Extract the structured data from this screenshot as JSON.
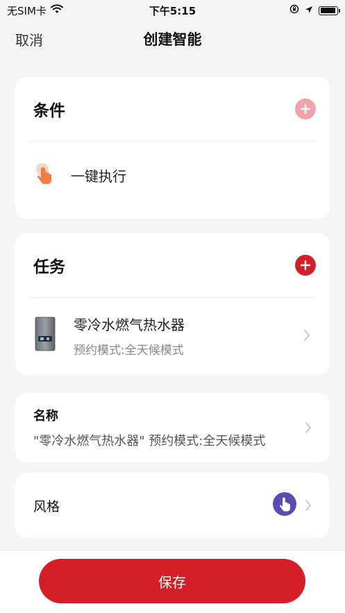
{
  "status_bar": {
    "carrier": "无SIM卡",
    "time": "下午5:15",
    "battery_level_percent": 95
  },
  "nav": {
    "cancel_label": "取消",
    "title": "创建智能"
  },
  "conditions": {
    "title": "条件",
    "add_button_color": "#f0a3aa",
    "items": [
      {
        "label": "一键执行",
        "icon": "tap-hand-icon"
      }
    ]
  },
  "tasks": {
    "title": "任务",
    "add_button_color": "#d51f26",
    "items": [
      {
        "name": "零冷水燃气热水器",
        "detail": "预约模式:全天候模式",
        "icon": "water-heater-icon"
      }
    ]
  },
  "name_field": {
    "label": "名称",
    "value": "\"零冷水燃气热水器\" 预约模式:全天候模式"
  },
  "style_field": {
    "label": "风格",
    "icon": "tap-hand-icon",
    "icon_color": "#5b4bb5"
  },
  "save": {
    "label": "保存",
    "color": "#d51f26"
  }
}
